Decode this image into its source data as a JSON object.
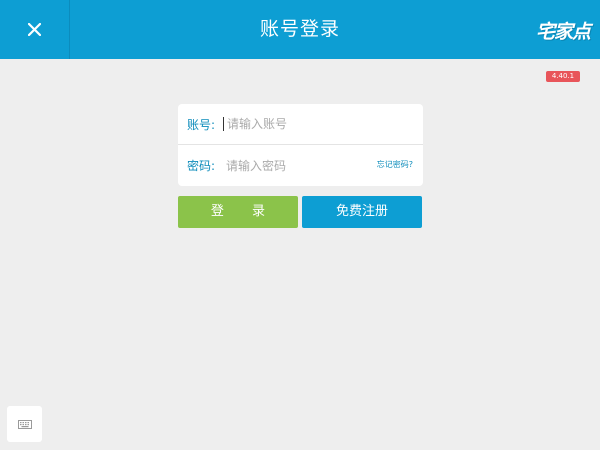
{
  "header": {
    "title": "账号登录",
    "logo_text": "宅家点",
    "close_icon": "close-icon"
  },
  "version_badge": "4.40.1",
  "form": {
    "account": {
      "label": "账号:",
      "placeholder": "请输入账号",
      "value": ""
    },
    "password": {
      "label": "密码:",
      "placeholder": "请输入密码",
      "value": "",
      "forgot_label": "忘记密码?"
    }
  },
  "buttons": {
    "login_label": "登 录",
    "register_label": "免费注册"
  },
  "keyboard_icon": "keyboard-icon",
  "colors": {
    "header": "#0d9ed3",
    "background": "#eeeeee",
    "login_button": "#8bc34a",
    "register_button": "#0d9ed3",
    "label": "#0d8cbb",
    "badge": "#e8555a"
  }
}
